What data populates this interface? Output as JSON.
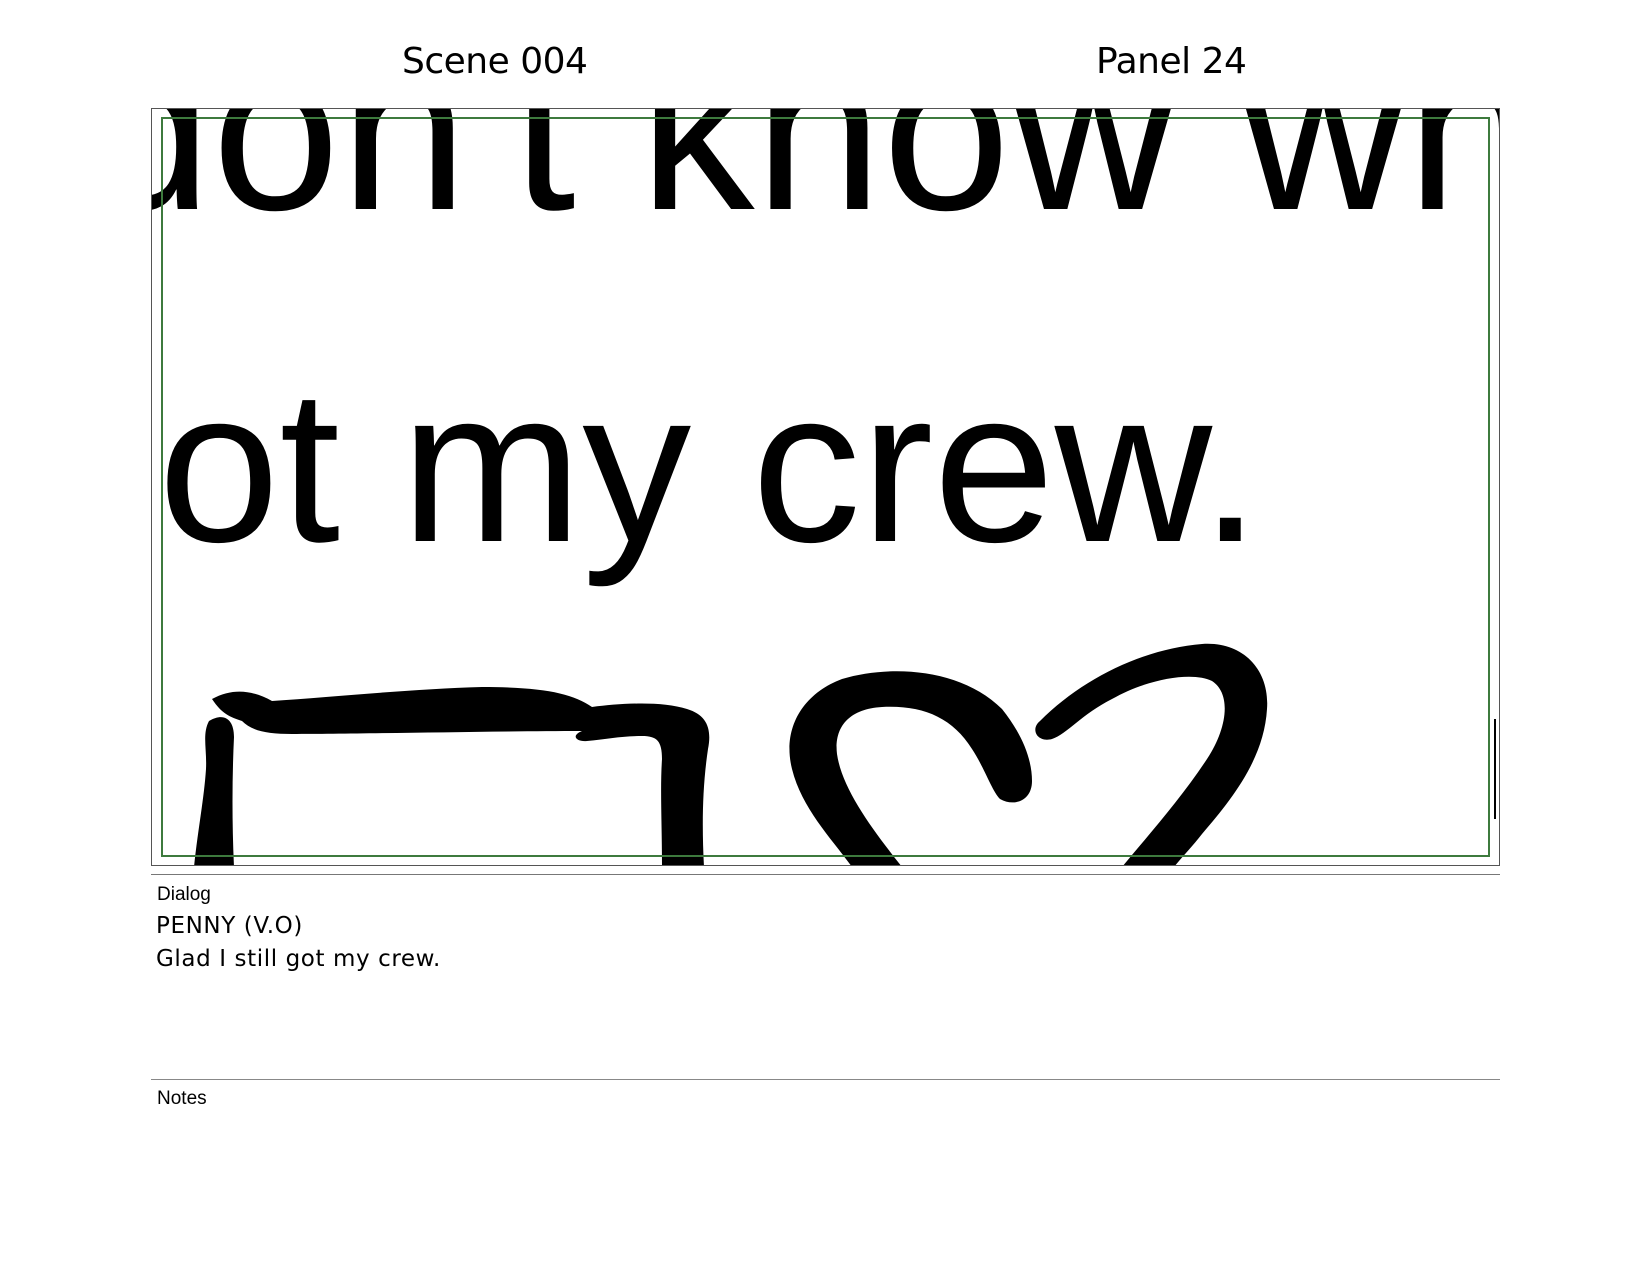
{
  "header": {
    "scene": "Scene 004",
    "panel": "Panel 24"
  },
  "panel_art": {
    "line1_text": "don't know wh",
    "line2_text": "got my crew."
  },
  "dialog": {
    "label": "Dialog",
    "speaker": "PENNY (V.O)",
    "text": "Glad I still got my crew."
  },
  "notes": {
    "label": "Notes"
  },
  "colors": {
    "safe_frame": "#3d7a3d",
    "ink": "#000000"
  }
}
